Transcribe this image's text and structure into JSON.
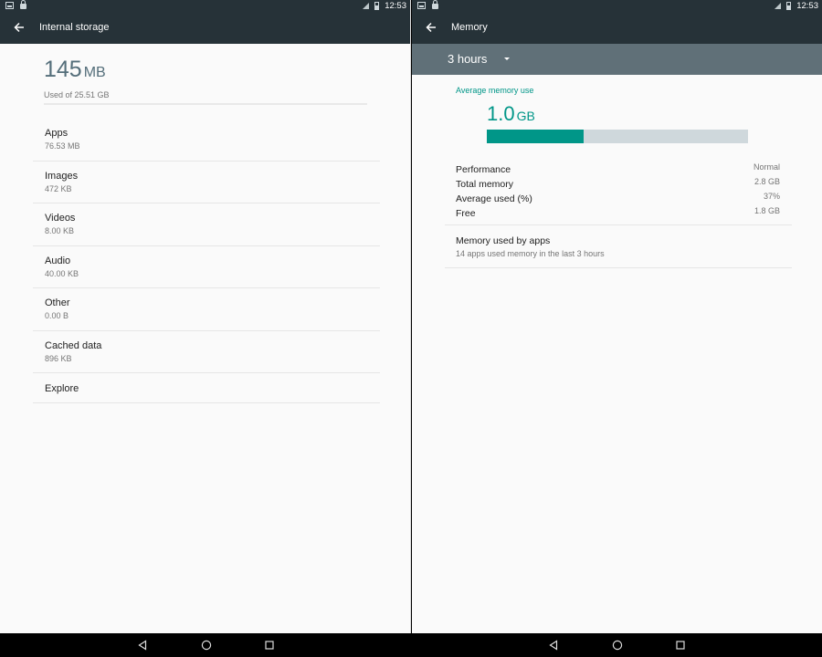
{
  "status_bar": {
    "time": "12:53"
  },
  "left": {
    "title": "Internal storage",
    "used_value": "145",
    "used_unit": "MB",
    "used_of": "Used of 25.51 GB",
    "items": [
      {
        "label": "Apps",
        "value": "76.53 MB"
      },
      {
        "label": "Images",
        "value": "472 KB"
      },
      {
        "label": "Videos",
        "value": "8.00 KB"
      },
      {
        "label": "Audio",
        "value": "40.00 KB"
      },
      {
        "label": "Other",
        "value": "0.00 B"
      },
      {
        "label": "Cached data",
        "value": "896 KB"
      }
    ],
    "explore": "Explore"
  },
  "right": {
    "title": "Memory",
    "time_range": "3 hours",
    "avg_label": "Average memory use",
    "avg_value": "1.0",
    "avg_unit": "GB",
    "avg_fraction": 0.37,
    "stats": [
      {
        "label": "Performance",
        "value": "Normal"
      },
      {
        "label": "Total memory",
        "value": "2.8 GB"
      },
      {
        "label": "Average used (%)",
        "value": "37%"
      },
      {
        "label": "Free",
        "value": "1.8 GB"
      }
    ],
    "apps_title": "Memory used by apps",
    "apps_subtitle": "14 apps used memory in the last 3 hours"
  },
  "colors": {
    "accent": "#009688",
    "toolbar": "#263238",
    "range_bar": "#607078",
    "bar_track": "#cfd8dc"
  },
  "icons": [
    "back-arrow-icon",
    "dropdown-caret-icon",
    "nav-back-icon",
    "nav-home-icon",
    "nav-recents-icon",
    "image-notification-icon",
    "lock-icon",
    "signal-icon",
    "battery-icon"
  ]
}
